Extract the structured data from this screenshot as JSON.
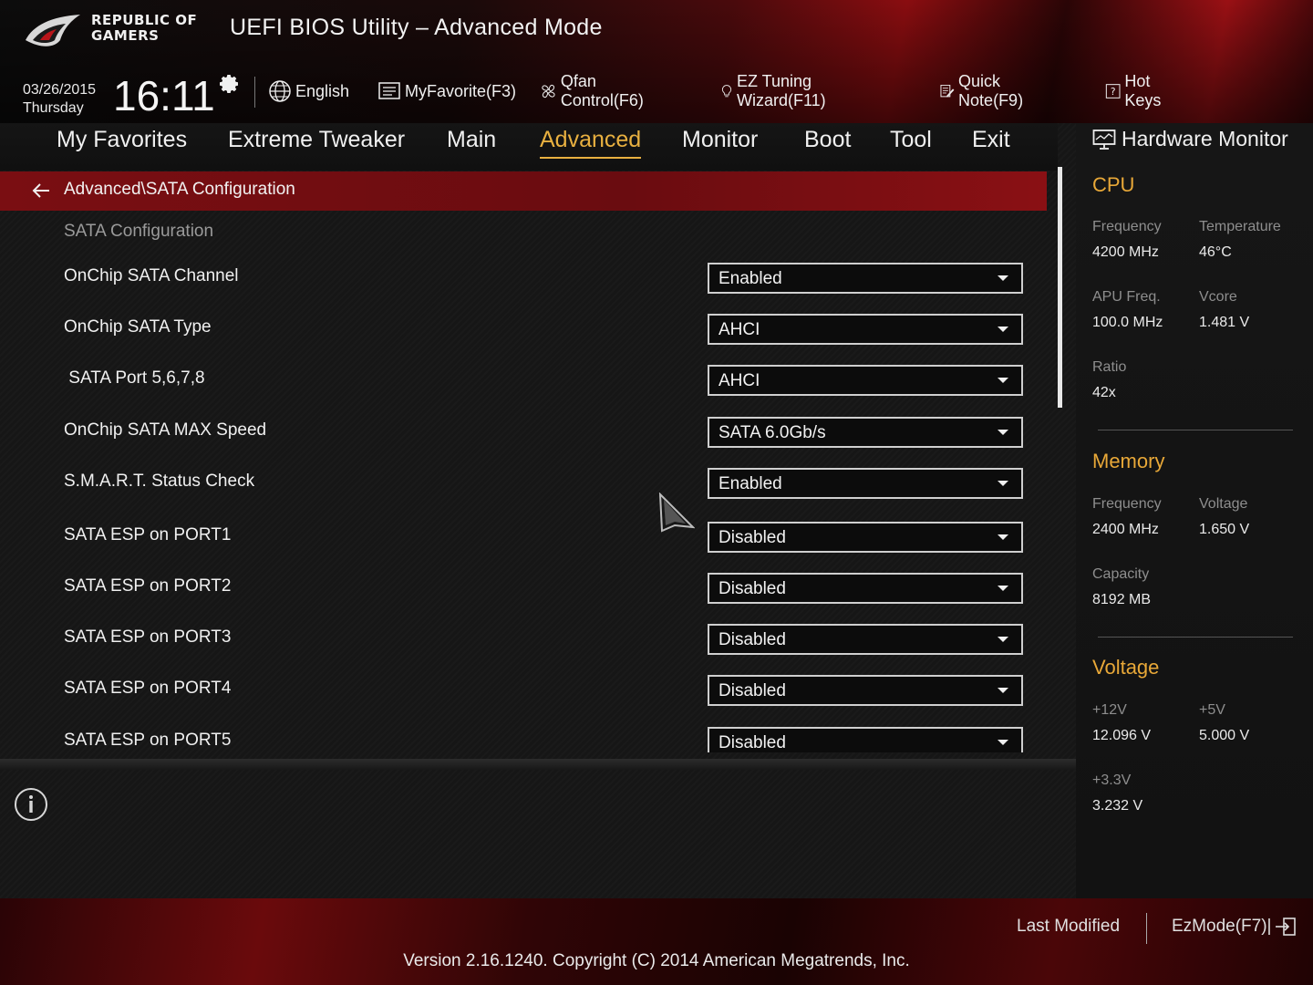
{
  "brand": {
    "line1": "REPUBLIC OF",
    "line2": "GAMERS"
  },
  "app_title": "UEFI BIOS Utility – Advanced Mode",
  "clock": {
    "date": "03/26/2015",
    "day": "Thursday",
    "time": "16:11"
  },
  "toolbar": {
    "language": "English",
    "myfavorite": "MyFavorite(F3)",
    "qfan": "Qfan Control(F6)",
    "ez_tuning": "EZ Tuning Wizard(F11)",
    "quick_note": "Quick Note(F9)",
    "hot_keys": "Hot Keys"
  },
  "menu": {
    "items": [
      "My Favorites",
      "Extreme Tweaker",
      "Main",
      "Advanced",
      "Monitor",
      "Boot",
      "Tool",
      "Exit"
    ],
    "active": "Advanced"
  },
  "breadcrumb": "Advanced\\SATA Configuration",
  "settings": {
    "section": "SATA Configuration",
    "rows": [
      {
        "label": "OnChip SATA Channel",
        "value": "Enabled"
      },
      {
        "label": "OnChip SATA Type",
        "value": "AHCI"
      },
      {
        "label": " SATA Port 5,6,7,8",
        "value": "AHCI"
      },
      {
        "label": "OnChip SATA MAX Speed",
        "value": "SATA 6.0Gb/s"
      },
      {
        "label": "S.M.A.R.T. Status Check",
        "value": "Enabled"
      },
      {
        "label": "SATA ESP on PORT1",
        "value": "Disabled"
      },
      {
        "label": "SATA ESP on PORT2",
        "value": "Disabled"
      },
      {
        "label": "SATA ESP on PORT3",
        "value": "Disabled"
      },
      {
        "label": "SATA ESP on PORT4",
        "value": "Disabled"
      },
      {
        "label": "SATA ESP on PORT5",
        "value": "Disabled"
      }
    ]
  },
  "hardware_monitor": {
    "title": "Hardware Monitor",
    "cpu": {
      "title": "CPU",
      "frequency_label": "Frequency",
      "frequency": "4200 MHz",
      "temperature_label": "Temperature",
      "temperature": "46°C",
      "apu_label": "APU Freq.",
      "apu": "100.0 MHz",
      "vcore_label": "Vcore",
      "vcore": "1.481 V",
      "ratio_label": "Ratio",
      "ratio": "42x"
    },
    "memory": {
      "title": "Memory",
      "frequency_label": "Frequency",
      "frequency": "2400 MHz",
      "voltage_label": "Voltage",
      "voltage": "1.650 V",
      "capacity_label": "Capacity",
      "capacity": "8192 MB"
    },
    "voltage": {
      "title": "Voltage",
      "v12_label": "+12V",
      "v12": "12.096 V",
      "v5_label": "+5V",
      "v5": "5.000 V",
      "v33_label": "+3.3V",
      "v33": "3.232 V"
    }
  },
  "footer": {
    "last_modified": "Last Modified",
    "ezmode": "EzMode(F7)|",
    "version": "Version 2.16.1240. Copyright (C) 2014 American Megatrends, Inc."
  },
  "colors": {
    "accent": "#e8a838",
    "brand_red": "#8a1014"
  }
}
